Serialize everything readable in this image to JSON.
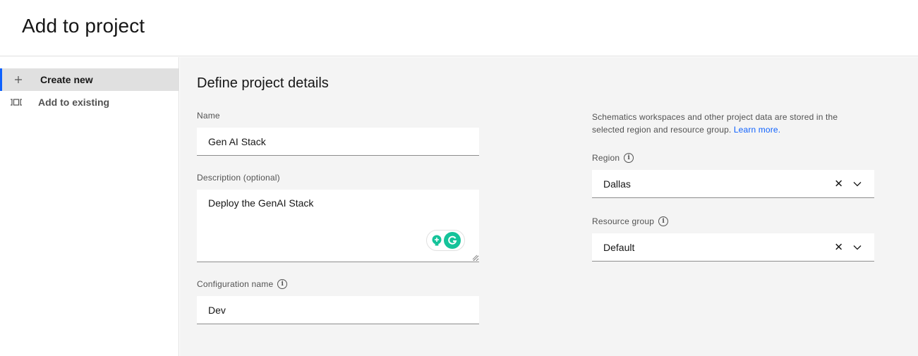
{
  "header": {
    "title": "Add to project"
  },
  "sidebar": {
    "items": [
      {
        "label": "Create new",
        "icon": "plus-icon",
        "active": true
      },
      {
        "label": "Add to existing",
        "icon": "add-existing-icon",
        "active": false
      }
    ]
  },
  "main": {
    "section_title": "Define project details",
    "name": {
      "label": "Name",
      "value": "Gen AI Stack"
    },
    "description": {
      "label": "Description (optional)",
      "value": "Deploy the GenAI Stack"
    },
    "configuration": {
      "label": "Configuration name",
      "value": "Dev",
      "info_icon": "info-icon"
    },
    "helper": {
      "text": "Schematics workspaces and other project data are stored in the selected region and resource group.",
      "link": "Learn more."
    },
    "region": {
      "label": "Region",
      "value": "Dallas",
      "info_icon": "info-icon"
    },
    "resource_group": {
      "label": "Resource group",
      "value": "Default",
      "info_icon": "info-icon"
    }
  },
  "colors": {
    "accent": "#0f62fe",
    "background": "#f4f4f4",
    "sidebar_active": "#e0e0e0",
    "grammarly": "#15c39a"
  }
}
